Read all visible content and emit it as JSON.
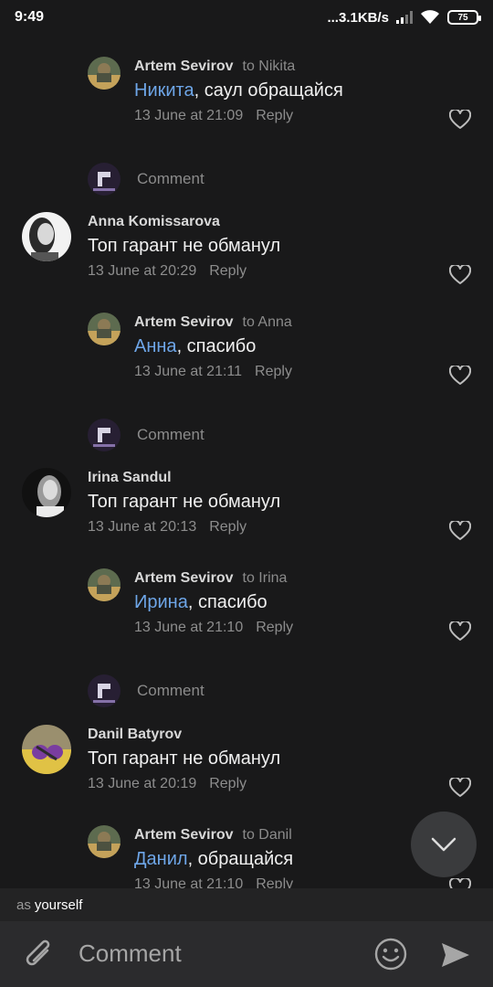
{
  "status": {
    "time": "9:49",
    "network": "...3.1KB/s",
    "battery": "75"
  },
  "thread": [
    {
      "type": "reply",
      "author": "Artem Sevirov",
      "to": "to Nikita",
      "mention": "Никита",
      "text": ", саул обращайся",
      "time": "13 June at 21:09",
      "reply": "Reply"
    },
    {
      "type": "comment-prompt",
      "placeholder": "Comment"
    },
    {
      "type": "comment",
      "author": "Anna Komissarova",
      "text": "Топ гарант не обманул",
      "time": "13 June at 20:29",
      "reply": "Reply"
    },
    {
      "type": "reply",
      "author": "Artem Sevirov",
      "to": "to Anna",
      "mention": "Анна",
      "text": ", спасибо",
      "time": "13 June at 21:11",
      "reply": "Reply"
    },
    {
      "type": "comment-prompt",
      "placeholder": "Comment"
    },
    {
      "type": "comment",
      "author": "Irina Sandul",
      "text": "Топ гарант не обманул",
      "time": "13 June at 20:13",
      "reply": "Reply"
    },
    {
      "type": "reply",
      "author": "Artem Sevirov",
      "to": "to Irina",
      "mention": "Ирина",
      "text": ", спасибо",
      "time": "13 June at 21:10",
      "reply": "Reply"
    },
    {
      "type": "comment-prompt",
      "placeholder": "Comment"
    },
    {
      "type": "comment",
      "author": "Danil Batyrov",
      "text": "Топ гарант не обманул",
      "time": "13 June at 20:19",
      "reply": "Reply"
    },
    {
      "type": "reply",
      "author": "Artem Sevirov",
      "to": "to Danil",
      "mention": "Данил",
      "text": ", обращайся",
      "time": "13 June at 21:10",
      "reply": "Reply"
    }
  ],
  "composer": {
    "as_prefix": "as",
    "as_name": "yourself",
    "placeholder": "Comment"
  },
  "icons": {
    "attach": "paperclip-icon",
    "emoji": "emoji-icon",
    "send": "send-icon",
    "like": "heart-icon",
    "scroll": "chevron-down-icon"
  }
}
